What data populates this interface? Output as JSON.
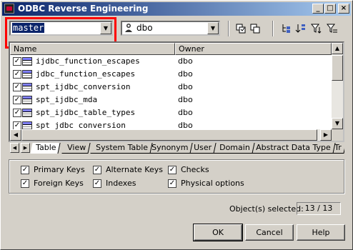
{
  "window": {
    "title": "ODBC Reverse Engineering",
    "controls": {
      "minimize": "_",
      "maximize": "□",
      "close": "×"
    }
  },
  "toolbar": {
    "database": {
      "value": "master"
    },
    "owner": {
      "value": "dbo"
    },
    "icons": [
      "select-all-icon",
      "deselect-all-icon",
      "filter-tree-icon",
      "sort-icon",
      "filter-icon",
      "clear-filter-icon"
    ]
  },
  "list": {
    "columns": [
      "Name",
      "Owner"
    ],
    "rows": [
      {
        "name": "ijdbc_function_escapes",
        "owner": "dbo",
        "checked": true
      },
      {
        "name": "jdbc_function_escapes",
        "owner": "dbo",
        "checked": true
      },
      {
        "name": "spt_ijdbc_conversion",
        "owner": "dbo",
        "checked": true
      },
      {
        "name": "spt_ijdbc_mda",
        "owner": "dbo",
        "checked": true
      },
      {
        "name": "spt_ijdbc_table_types",
        "owner": "dbo",
        "checked": true
      },
      {
        "name": "spt_jdbc_conversion",
        "owner": "dbo",
        "checked": true
      }
    ]
  },
  "tabs": [
    "Table",
    "View",
    "System Table",
    "Synonym",
    "User",
    "Domain",
    "Abstract Data Type",
    "Tr"
  ],
  "active_tab": "Table",
  "options": {
    "primary_keys": "Primary Keys",
    "alternate_keys": "Alternate Keys",
    "checks": "Checks",
    "foreign_keys": "Foreign Keys",
    "indexes": "Indexes",
    "physical_options": "Physical options"
  },
  "selection": {
    "label": "Object(s) selected:",
    "value": "13 / 13"
  },
  "buttons": {
    "ok": "OK",
    "cancel": "Cancel",
    "help": "Help"
  }
}
